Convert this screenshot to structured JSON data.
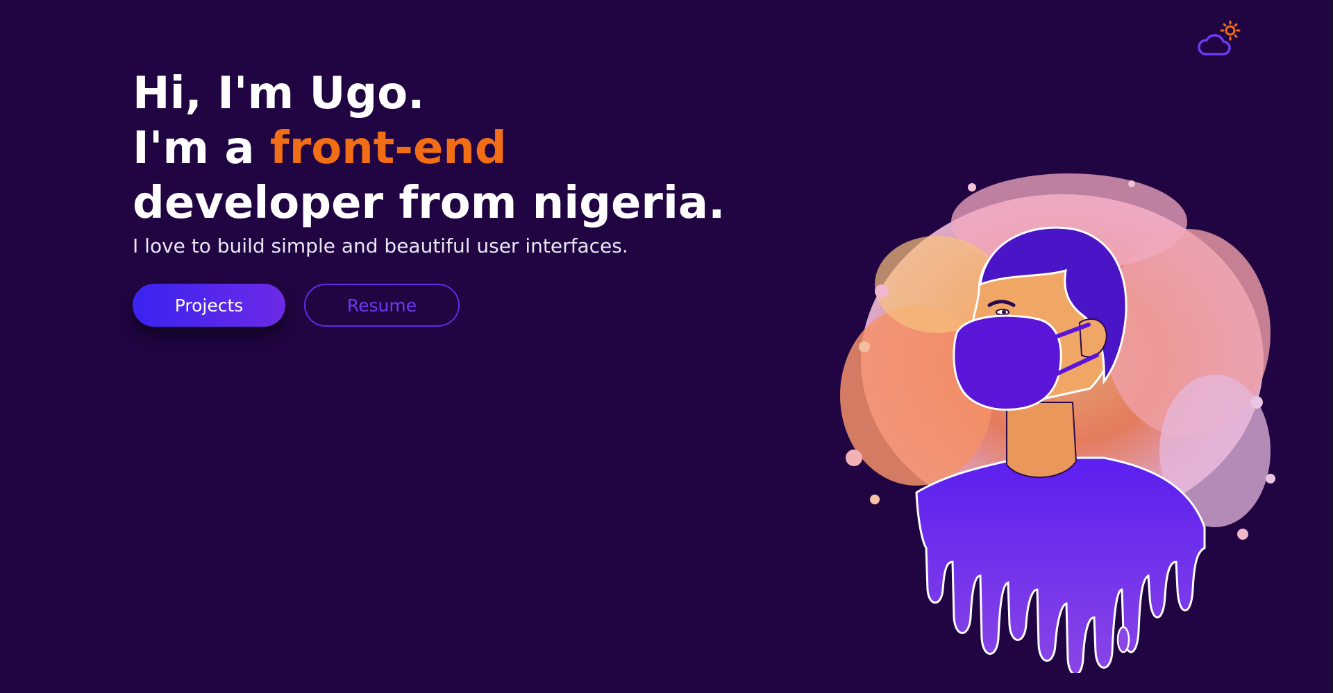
{
  "theme_toggle": {
    "icon": "cloud-sun-icon",
    "colors": {
      "sun": "#f26e16",
      "cloud": "#6c3bf0"
    }
  },
  "hero": {
    "line1": "Hi, I'm Ugo.",
    "line2_prefix": "I'm a ",
    "line2_accent": "front-end",
    "line3": "developer from nigeria.",
    "tagline": "I love to build simple and beautiful user interfaces."
  },
  "buttons": {
    "projects_label": "Projects",
    "resume_label": "Resume"
  },
  "colors": {
    "background": "#200542",
    "accent": "#f26e16",
    "primary_button": "#3a23f0",
    "outline_button": "#5b2ee6"
  },
  "illustration": {
    "icon": "masked-developer-portrait",
    "colors": {
      "shirt": "#5b1ff0",
      "mask": "#5a15d8",
      "skin": "#f0a766",
      "splash": "#f5865f"
    }
  }
}
